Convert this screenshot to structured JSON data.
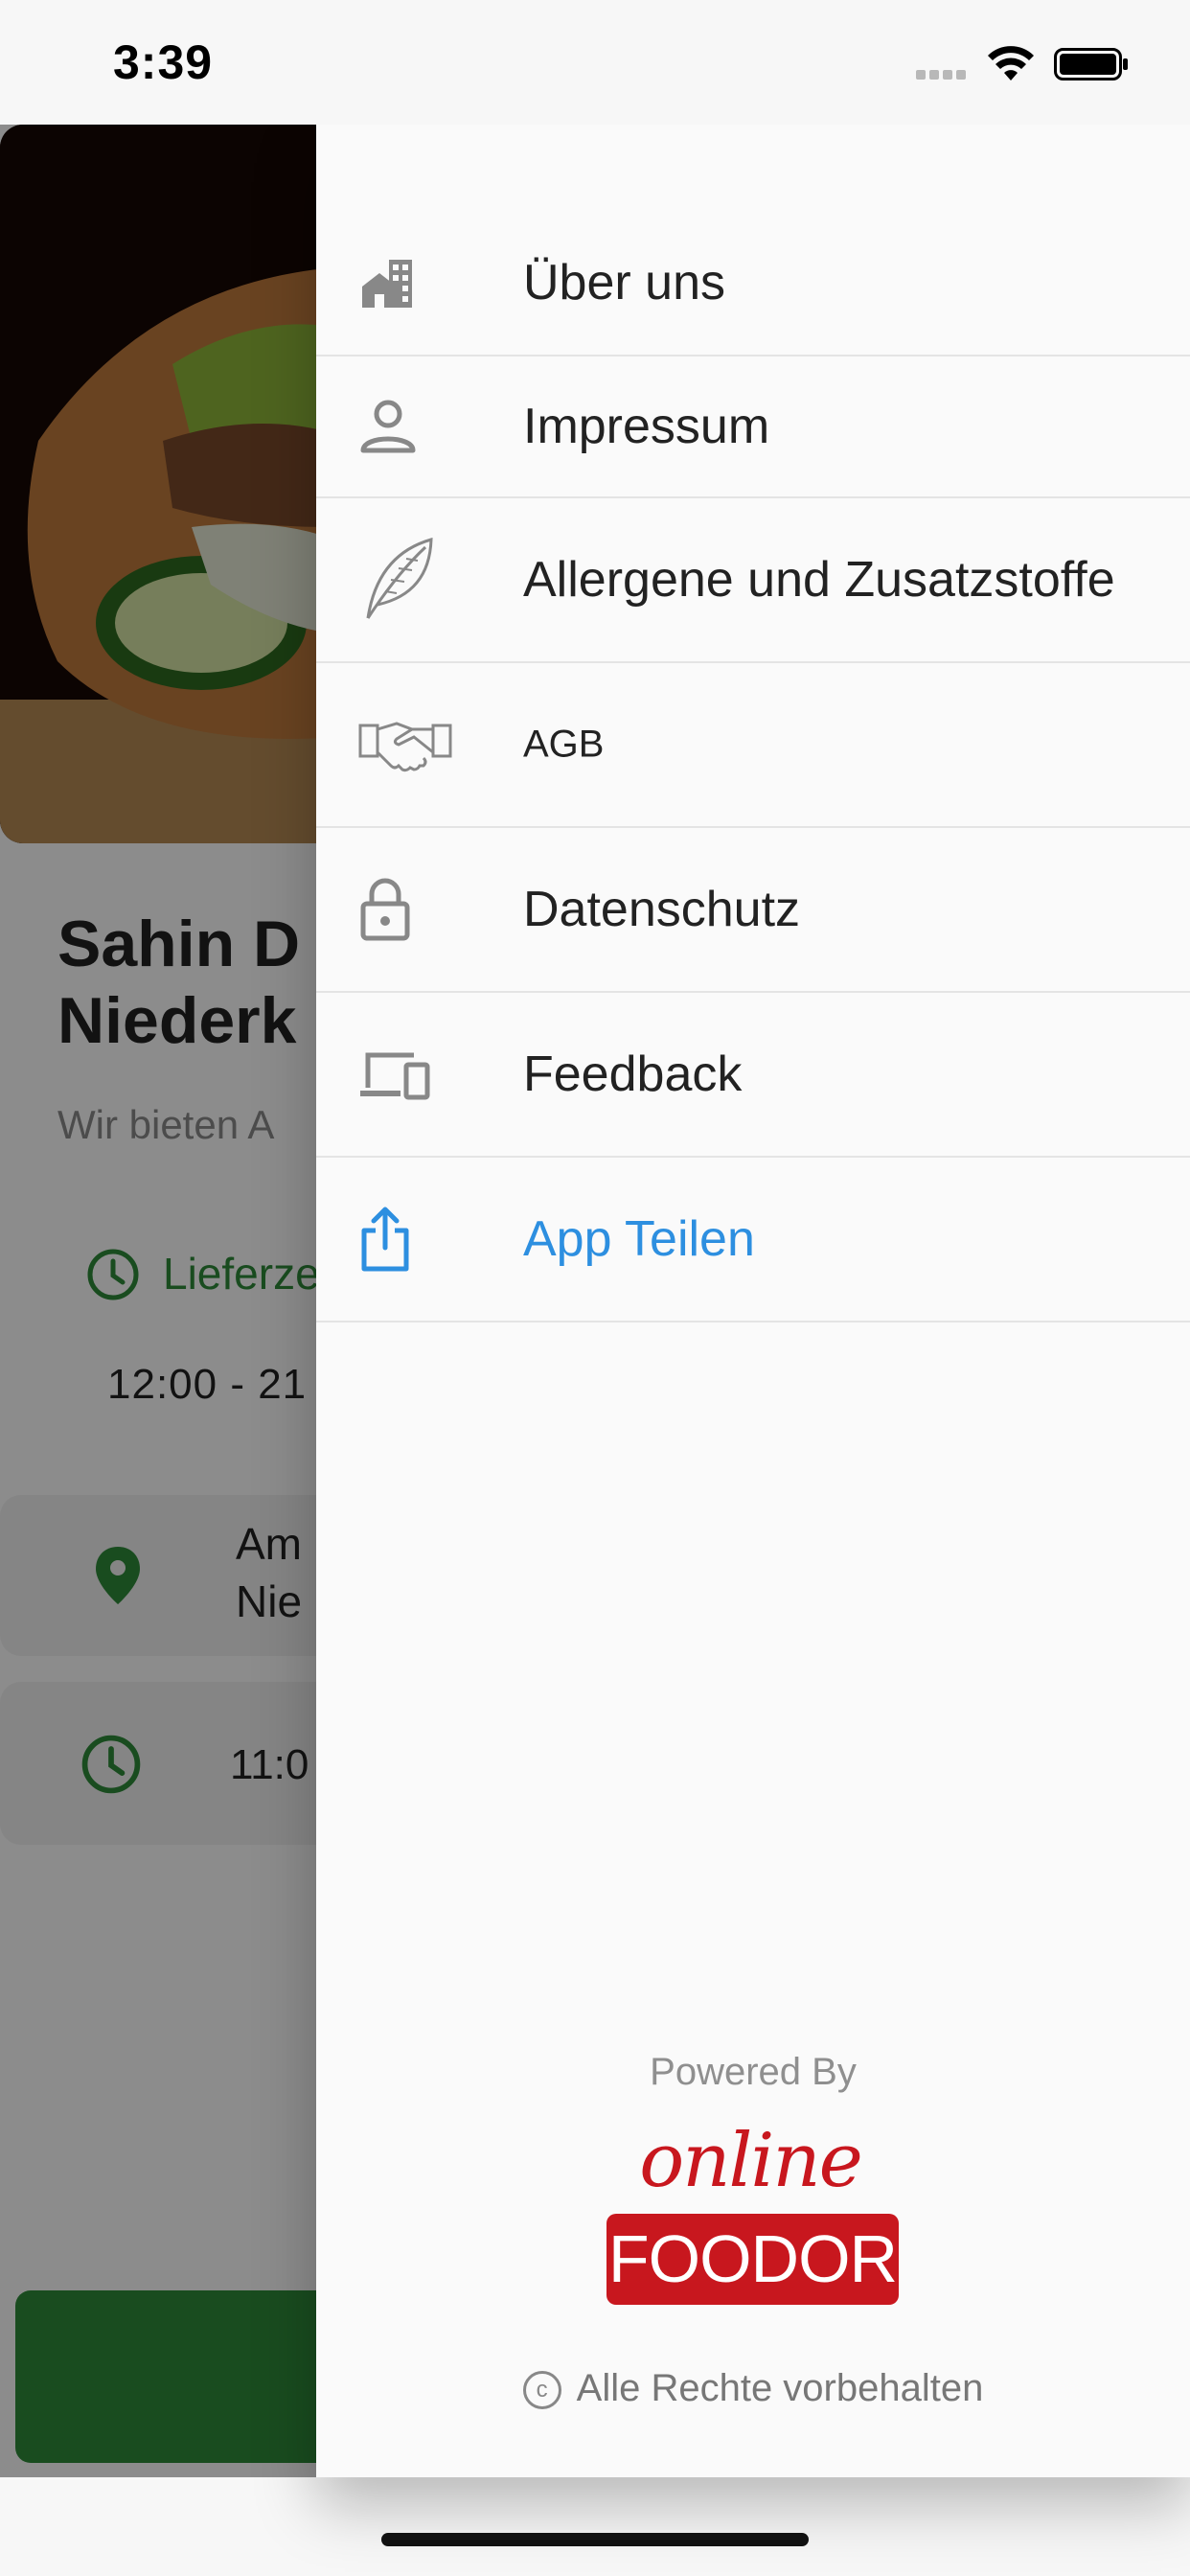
{
  "status_bar": {
    "time": "3:39"
  },
  "background": {
    "title_line1": "Sahin D",
    "title_line2": "Niederk",
    "subtitle": "Wir bieten A",
    "delivery_label": "Lieferze",
    "delivery_hours": "12:00 - 21",
    "address_line1": "Am",
    "address_line2": "Nie",
    "opening_hours": "11:0",
    "accent_color": "#2f8a3a"
  },
  "drawer": {
    "menu": [
      {
        "label": "Über uns",
        "icon": "building-icon"
      },
      {
        "label": "Impressum",
        "icon": "person-icon"
      },
      {
        "label": "Allergene und Zusatzstoffe",
        "icon": "leaf-icon"
      },
      {
        "label": "AGB",
        "icon": "handshake-icon"
      },
      {
        "label": "Datenschutz",
        "icon": "lock-icon"
      },
      {
        "label": "Feedback",
        "icon": "devices-icon"
      },
      {
        "label": "App Teilen",
        "icon": "share-icon",
        "color": "#2d8fe0"
      }
    ],
    "powered_by": "Powered By",
    "logo_script": "online",
    "logo_box": "FOODOR",
    "copyright_symbol": "c",
    "copyright": "Alle Rechte vorbehalten"
  }
}
